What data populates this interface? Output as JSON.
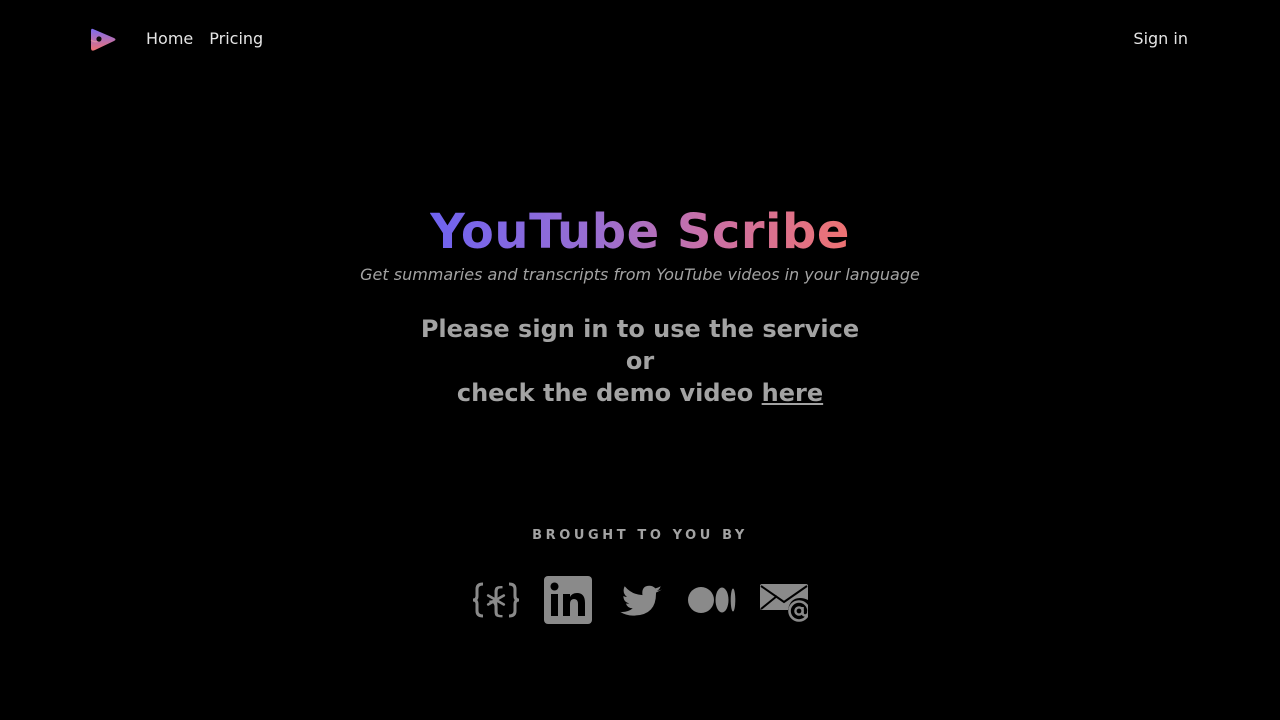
{
  "header": {
    "logo_icon": "play-logo-icon",
    "nav": [
      {
        "label": "Home"
      },
      {
        "label": "Pricing"
      }
    ],
    "signin_label": "Sign in"
  },
  "hero": {
    "title": "YouTube Scribe",
    "subtitle": "Get summaries and transcripts from YouTube videos in your language",
    "line1": "Please sign in to use the service",
    "line2": "or",
    "line3_prefix": "check the demo video ",
    "link_label": "here"
  },
  "footer": {
    "brought_label": "BROUGHT TO YOU BY",
    "socials": [
      {
        "icon": "code-braces-icon"
      },
      {
        "icon": "linkedin-icon"
      },
      {
        "icon": "twitter-icon"
      },
      {
        "icon": "medium-icon"
      },
      {
        "icon": "email-icon"
      }
    ]
  },
  "colors": {
    "background": "#000000",
    "muted_text": "#a3a3a3",
    "icon_gray": "#8a8a8a",
    "gradient_start": "#6f63f0",
    "gradient_end": "#ee7272"
  }
}
